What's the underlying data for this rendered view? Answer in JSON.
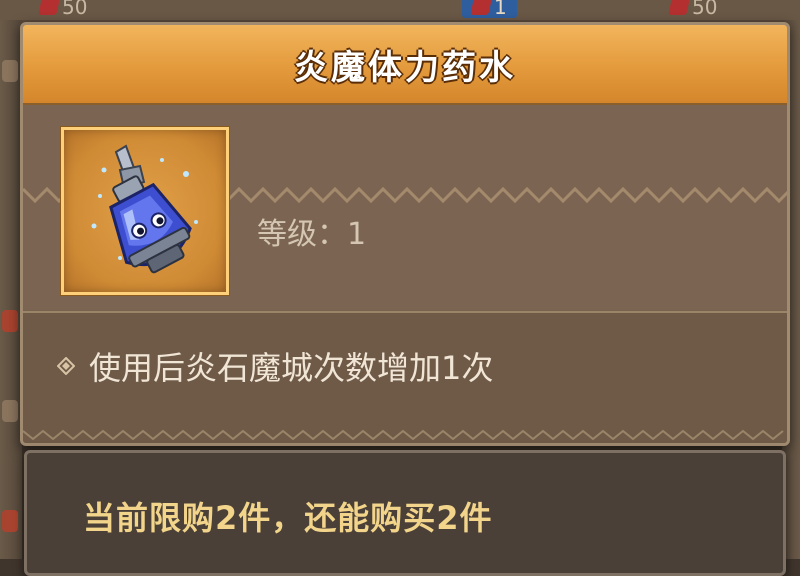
{
  "background": {
    "chips": [
      {
        "value": "50"
      },
      {
        "value": "1"
      },
      {
        "value": "50"
      }
    ]
  },
  "item": {
    "name": "炎魔体力药水",
    "icon": "blue-potion-bottle-icon",
    "level_label": "等级：",
    "level_value": "1",
    "description": "使用后炎石魔城次数增加1次"
  },
  "purchase": {
    "limit_text": "当前限购2件，还能购买2件"
  },
  "colors": {
    "header_orange": "#e39a3c",
    "panel_brown": "#77624f",
    "limit_gold": "#f2d48a",
    "icon_frame_gold": "#ffd07a"
  }
}
